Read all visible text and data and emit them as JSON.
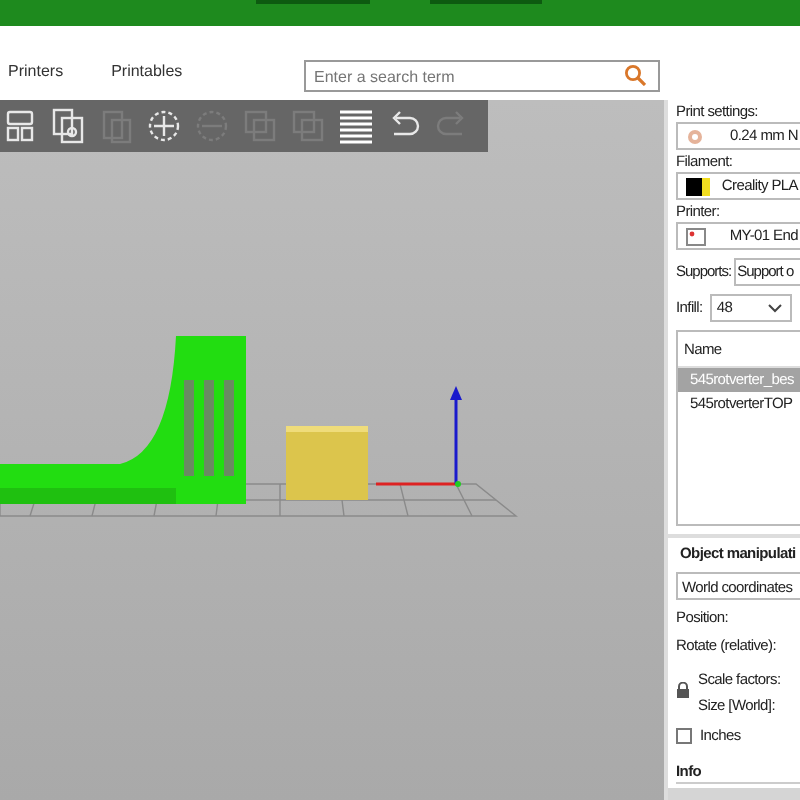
{
  "nav": {
    "links": [
      "Printers",
      "Printables"
    ],
    "search": {
      "placeholder": "Enter a search term"
    }
  },
  "toolbar": [
    {
      "kind": "arrange",
      "disabled": false
    },
    {
      "kind": "copy",
      "disabled": false
    },
    {
      "kind": "paste",
      "disabled": true
    },
    {
      "kind": "add",
      "disabled": false
    },
    {
      "kind": "remove",
      "disabled": true
    },
    {
      "kind": "split",
      "disabled": true
    },
    {
      "kind": "split",
      "disabled": true
    },
    {
      "kind": "layers",
      "disabled": false
    },
    {
      "kind": "undo",
      "disabled": false
    },
    {
      "kind": "redo",
      "disabled": true
    }
  ],
  "sidebar": {
    "print_settings": {
      "label": "Print settings:",
      "value": "0.24 mm N"
    },
    "filament": {
      "label": "Filament:",
      "value": "Creality PLA",
      "color": "#000000"
    },
    "printer": {
      "label": "Printer:",
      "value": "MY-01 End"
    },
    "supports": {
      "label": "Supports:",
      "value": "Support o"
    },
    "infill": {
      "label": "Infill:",
      "value": "48"
    },
    "objects": {
      "header": "Name",
      "rows": [
        {
          "name": "545rotverter_bes",
          "selected": true
        },
        {
          "name": "545rotverterTOP",
          "selected": false
        }
      ]
    },
    "object_manipulation": {
      "title": "Object manipulati",
      "coordinates": "World coordinates",
      "position": "Position:",
      "rotate": "Rotate (relative):",
      "scale": "Scale factors:",
      "size": "Size [World]:",
      "inches": {
        "label": "Inches",
        "checked": false
      }
    },
    "info": {
      "title": "Info"
    }
  }
}
